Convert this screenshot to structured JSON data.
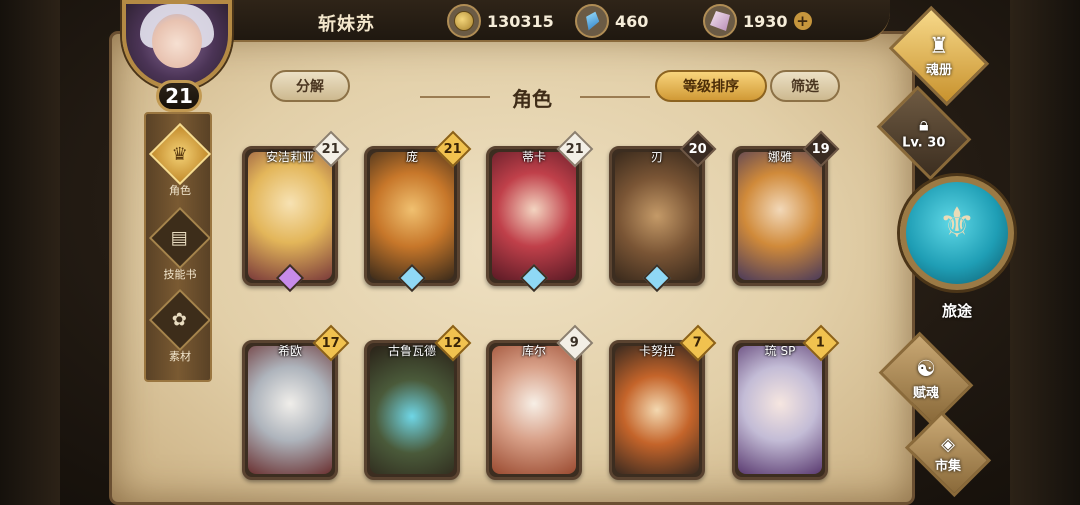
{
  "player": {
    "name": "斩妹苏",
    "level": "21"
  },
  "currencies": [
    {
      "icon": "gold-coin-icon",
      "value": "130315"
    },
    {
      "icon": "blue-crystal-icon",
      "value": "460"
    },
    {
      "icon": "pink-crystal-icon",
      "value": "1930",
      "has_add": true
    }
  ],
  "left_nav": [
    {
      "label": "角色",
      "icon": "character-icon",
      "active": true
    },
    {
      "label": "技能书",
      "icon": "skill-book-icon",
      "active": false
    },
    {
      "label": "素材",
      "icon": "material-icon",
      "active": false
    }
  ],
  "header": {
    "decompose_label": "分解",
    "title": "角色",
    "sort_label": "等级排序",
    "filter_label": "筛选"
  },
  "characters": [
    {
      "name": "安洁莉亚",
      "level": "21",
      "badge": "white",
      "rarity": "purple",
      "palette": "blonde"
    },
    {
      "name": "庞",
      "level": "21",
      "badge": "gold",
      "rarity": "blue",
      "palette": "tiger"
    },
    {
      "name": "蒂卡",
      "level": "21",
      "badge": "white",
      "rarity": "blue",
      "palette": "red"
    },
    {
      "name": "刃",
      "level": "20",
      "badge": "dark",
      "rarity": "blue",
      "palette": "bear"
    },
    {
      "name": "娜雅",
      "level": "19",
      "badge": "dark",
      "rarity": "",
      "palette": "ginger"
    },
    {
      "name": "希欧",
      "level": "17",
      "badge": "gold",
      "rarity": "",
      "palette": "silver"
    },
    {
      "name": "古鲁瓦德",
      "level": "12",
      "badge": "gold",
      "rarity": "",
      "palette": "dragon"
    },
    {
      "name": "库尔",
      "level": "9",
      "badge": "white",
      "rarity": "",
      "palette": "fox"
    },
    {
      "name": "卡努拉",
      "level": "7",
      "badge": "gold",
      "rarity": "",
      "palette": "lizard"
    },
    {
      "name": "琉 SP",
      "level": "1",
      "badge": "gold",
      "rarity": "",
      "palette": "purple"
    }
  ],
  "right_menu": {
    "soul_book_label": "魂册",
    "locked_label": "Lv. 30",
    "journey_label": "旅途",
    "soul_grant_label": "赋魂",
    "market_label": "市集"
  },
  "colors": {
    "gold_accent": "#d19a36",
    "parchment": "#e2cfa8",
    "journey_teal": "#1f9eb5"
  }
}
